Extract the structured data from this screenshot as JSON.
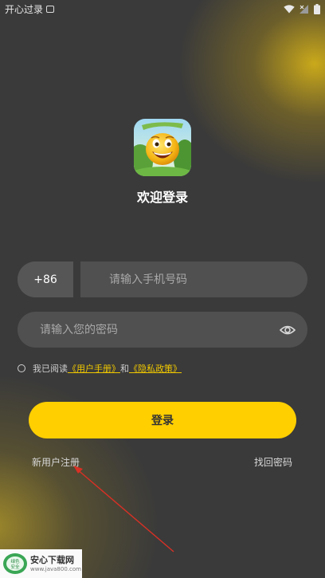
{
  "status_bar": {
    "app_label": "开心过录",
    "wifi_icon": "wifi-icon",
    "no_signal_icon": "signal-x-icon",
    "battery_icon": "battery-icon"
  },
  "app": {
    "logo_icon": "smiley-emoji-app-icon",
    "welcome": "欢迎登录"
  },
  "form": {
    "country_code": "+86",
    "phone_placeholder": "请输入手机号码",
    "phone_value": "",
    "password_placeholder": "请输入您的密码",
    "password_value": "",
    "eye_icon": "eye-icon",
    "agreement": {
      "checked": false,
      "prefix": "我已阅读",
      "user_manual": "《用户手册》",
      "and": "和",
      "privacy_policy": "《隐私政策》"
    },
    "login_label": "登录",
    "register_label": "新用户注册",
    "forgot_label": "找回密码"
  },
  "annotation": {
    "color": "#d93025"
  },
  "watermark": {
    "title": "安心下载网",
    "url": "www.java800.com",
    "badge_text": "绿色\n安全"
  },
  "colors": {
    "background": "#3a3a3a",
    "accent": "#ffcf00",
    "input_bg": "#505050",
    "link": "#f0c800"
  }
}
